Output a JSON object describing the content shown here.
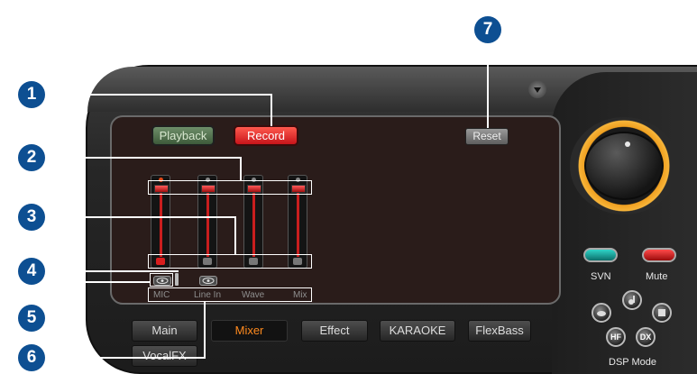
{
  "panel": {
    "playback_label": "Playback",
    "record_label": "Record",
    "reset_label": "Reset"
  },
  "channels": [
    {
      "label": "MIC"
    },
    {
      "label": "Line In"
    },
    {
      "label": "Wave"
    },
    {
      "label": "Mix"
    }
  ],
  "tabs": [
    {
      "label": "Main"
    },
    {
      "label": "Mixer"
    },
    {
      "label": "Effect"
    },
    {
      "label": "KARAOKE"
    },
    {
      "label": "FlexBass"
    },
    {
      "label": "VocalFX"
    }
  ],
  "active_tab": "Mixer",
  "right": {
    "svn_label": "SVN",
    "mute_label": "Mute",
    "dsp_label": "DSP Mode",
    "dsp_buttons": [
      "HF",
      "DX"
    ]
  },
  "callouts": [
    "1",
    "2",
    "3",
    "4",
    "5",
    "6",
    "7"
  ],
  "colors": {
    "accent_orange": "#ff8a1e",
    "record_red": "#d81e1e",
    "callout_blue": "#0d4f92",
    "svn_teal": "#2fd4c8"
  },
  "icons": [
    "eye-icon",
    "scroll-down-icon",
    "dsp-mode-icon"
  ]
}
